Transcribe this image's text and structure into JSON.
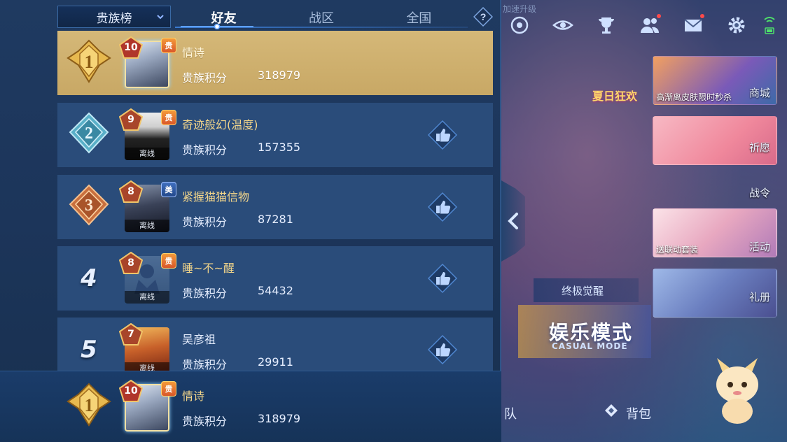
{
  "dropdown": {
    "label": "贵族榜"
  },
  "tabs": [
    {
      "label": "好友",
      "active": true
    },
    {
      "label": "战区",
      "active": false
    },
    {
      "label": "全国",
      "active": false
    }
  ],
  "score_label": "贵族积分",
  "offline_label": "离线",
  "rows": [
    {
      "rank": "1",
      "level": "10",
      "name": "情诗",
      "score": "318979",
      "badge": "贵",
      "offline": false,
      "is_self": true
    },
    {
      "rank": "2",
      "level": "9",
      "name": "奇迹般幻(温度)",
      "score": "157355",
      "badge": "贵",
      "offline": true,
      "is_self": false
    },
    {
      "rank": "3",
      "level": "8",
      "name": "紧握猫猫信物",
      "score": "87281",
      "badge": "美",
      "offline": true,
      "is_self": false
    },
    {
      "rank": "4",
      "level": "8",
      "name": "睡~不~醒",
      "score": "54432",
      "badge": "贵",
      "offline": true,
      "is_self": false
    },
    {
      "rank": "5",
      "level": "7",
      "name": "吴彦祖",
      "score": "29911",
      "badge": "",
      "offline": true,
      "is_self": false
    }
  ],
  "footer": {
    "rank": "1",
    "level": "10",
    "name": "情诗",
    "score": "318979",
    "badge": "贵"
  },
  "lobby": {
    "top_note": "加速升级",
    "event_title": "夏日狂欢",
    "promos": [
      {
        "caption": "高渐离皮肤限时秒杀",
        "tag": "商城"
      },
      {
        "caption": "",
        "tag": "祈愿"
      },
      {
        "caption": "送联动套装",
        "tag": "活动"
      },
      {
        "caption": "",
        "tag": "礼册"
      }
    ],
    "battle_pass": "战令",
    "awaken": "终极觉醒",
    "mode_title": "娱乐模式",
    "mode_sub": "CASUAL MODE",
    "nav_team": "队",
    "nav_bag": "背包"
  },
  "colors": {
    "panel_bg": "#1f3a61",
    "row_bg": "#2a4c7a",
    "self_row_bg": "#d5b878",
    "accent_blue": "#3a7ad0",
    "gold": "#f2d58a"
  }
}
